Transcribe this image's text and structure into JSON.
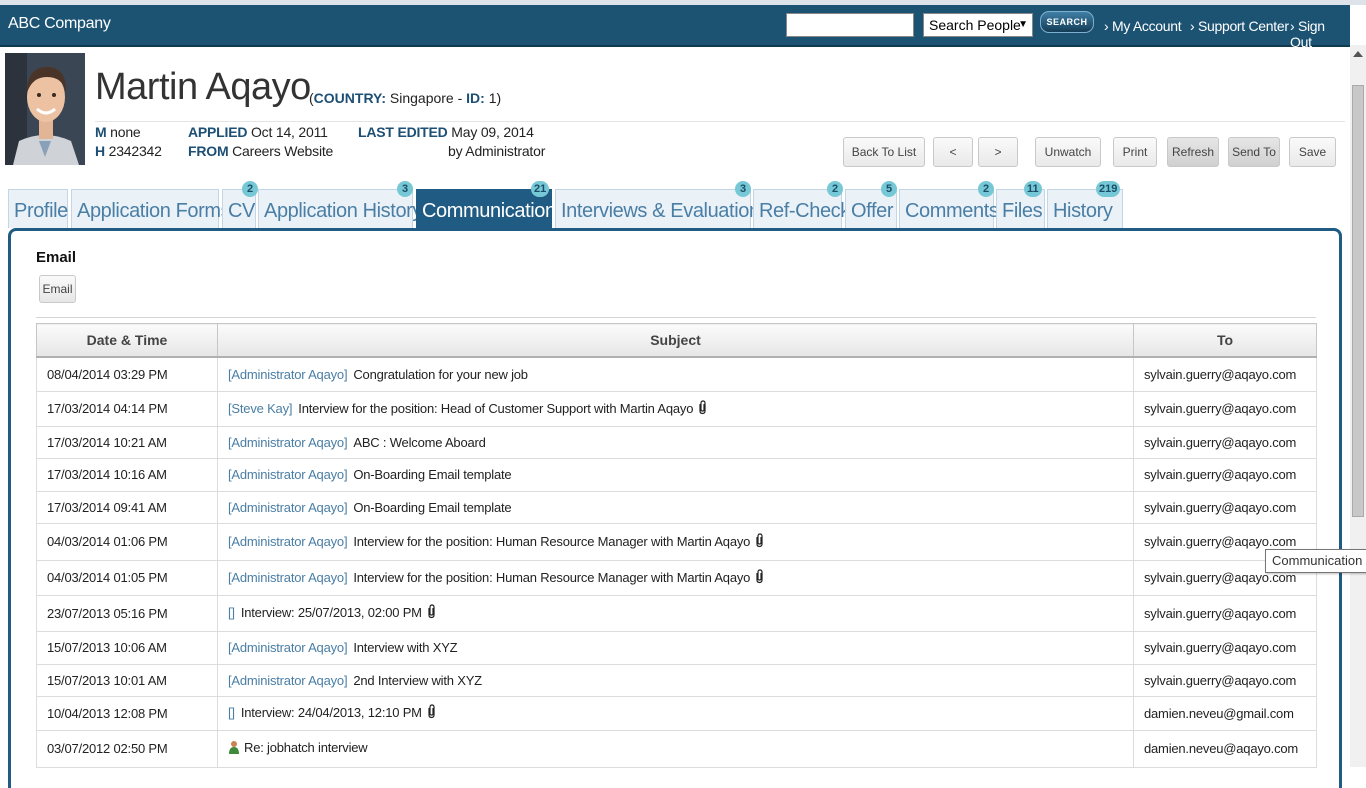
{
  "app": {
    "title": "ABC Company"
  },
  "search": {
    "value": "",
    "category": "Search People",
    "button": "SEARCH"
  },
  "nav": {
    "my_account": "› My Account",
    "support_center": "› Support Center",
    "sign_out": "› Sign Out"
  },
  "candidate": {
    "name": "Martin Aqayo",
    "country_label": "COUNTRY:",
    "country": "Singapore",
    "id_label": "ID:",
    "id": "1",
    "gender_label": "M",
    "gender_value": "none",
    "phone_label": "H",
    "phone_value": "2342342",
    "applied_label": "APPLIED",
    "applied_value": "Oct 14, 2011",
    "from_label": "FROM",
    "from_value": "Careers Website",
    "last_edited_label": "LAST EDITED",
    "last_edited_value": "May 09, 2014",
    "edited_by": "by Administrator"
  },
  "actions": {
    "back": "Back To List",
    "prev": "<",
    "next": ">",
    "unwatch": "Unwatch",
    "print": "Print",
    "refresh": "Refresh",
    "send_to": "Send To",
    "save": "Save"
  },
  "tabs": [
    {
      "label": "Profile",
      "badge": ""
    },
    {
      "label": "Application Forms",
      "badge": ""
    },
    {
      "label": "CV",
      "badge": "2"
    },
    {
      "label": "Application History",
      "badge": "3"
    },
    {
      "label": "Communication",
      "badge": "21"
    },
    {
      "label": "Interviews & Evaluations",
      "badge": "3"
    },
    {
      "label": "Ref-Check",
      "badge": "2"
    },
    {
      "label": "Offer",
      "badge": "5"
    },
    {
      "label": "Comments",
      "badge": "2"
    },
    {
      "label": "Files",
      "badge": "11"
    },
    {
      "label": "History",
      "badge": "219"
    }
  ],
  "communication": {
    "section_title": "Email",
    "email_button": "Email",
    "columns": {
      "date": "Date & Time",
      "subject": "Subject",
      "to": "To"
    },
    "rows": [
      {
        "date": "08/04/2014 03:29 PM",
        "sender": "[Administrator Aqayo]",
        "subject": "Congratulation for your new job",
        "attachment": false,
        "person_icon": false,
        "to": "sylvain.guerry@aqayo.com"
      },
      {
        "date": "17/03/2014 04:14 PM",
        "sender": "[Steve Kay]",
        "subject": "Interview for the position: Head of Customer Support with Martin Aqayo",
        "attachment": true,
        "person_icon": false,
        "to": "sylvain.guerry@aqayo.com"
      },
      {
        "date": "17/03/2014 10:21 AM",
        "sender": "[Administrator Aqayo]",
        "subject": "ABC : Welcome Aboard",
        "attachment": false,
        "person_icon": false,
        "to": "sylvain.guerry@aqayo.com"
      },
      {
        "date": "17/03/2014 10:16 AM",
        "sender": "[Administrator Aqayo]",
        "subject": "On-Boarding Email template",
        "attachment": false,
        "person_icon": false,
        "to": "sylvain.guerry@aqayo.com"
      },
      {
        "date": "17/03/2014 09:41 AM",
        "sender": "[Administrator Aqayo]",
        "subject": "On-Boarding Email template",
        "attachment": false,
        "person_icon": false,
        "to": "sylvain.guerry@aqayo.com"
      },
      {
        "date": "04/03/2014 01:06 PM",
        "sender": "[Administrator Aqayo]",
        "subject": "Interview for the position: Human Resource Manager with Martin Aqayo",
        "attachment": true,
        "person_icon": false,
        "to": "sylvain.guerry@aqayo.com"
      },
      {
        "date": "04/03/2014 01:05 PM",
        "sender": "[Administrator Aqayo]",
        "subject": "Interview for the position: Human Resource Manager with Martin Aqayo",
        "attachment": true,
        "person_icon": false,
        "to": "sylvain.guerry@aqayo.com"
      },
      {
        "date": "23/07/2013 05:16 PM",
        "sender": "[]",
        "subject": "Interview: 25/07/2013, 02:00 PM",
        "attachment": true,
        "person_icon": false,
        "to": "sylvain.guerry@aqayo.com"
      },
      {
        "date": "15/07/2013 10:06 AM",
        "sender": "[Administrator Aqayo]",
        "subject": "Interview with XYZ",
        "attachment": false,
        "person_icon": false,
        "to": "sylvain.guerry@aqayo.com"
      },
      {
        "date": "15/07/2013 10:01 AM",
        "sender": "[Administrator Aqayo]",
        "subject": "2nd Interview with XYZ",
        "attachment": false,
        "person_icon": false,
        "to": "sylvain.guerry@aqayo.com"
      },
      {
        "date": "10/04/2013 12:08 PM",
        "sender": "[]",
        "subject": "Interview: 24/04/2013, 12:10 PM",
        "attachment": true,
        "person_icon": false,
        "to": "damien.neveu@gmail.com"
      },
      {
        "date": "03/07/2012 02:50 PM",
        "sender": "",
        "subject": "Re: jobhatch interview",
        "attachment": false,
        "person_icon": true,
        "to": "damien.neveu@aqayo.com"
      }
    ]
  },
  "tooltip": "Communication"
}
